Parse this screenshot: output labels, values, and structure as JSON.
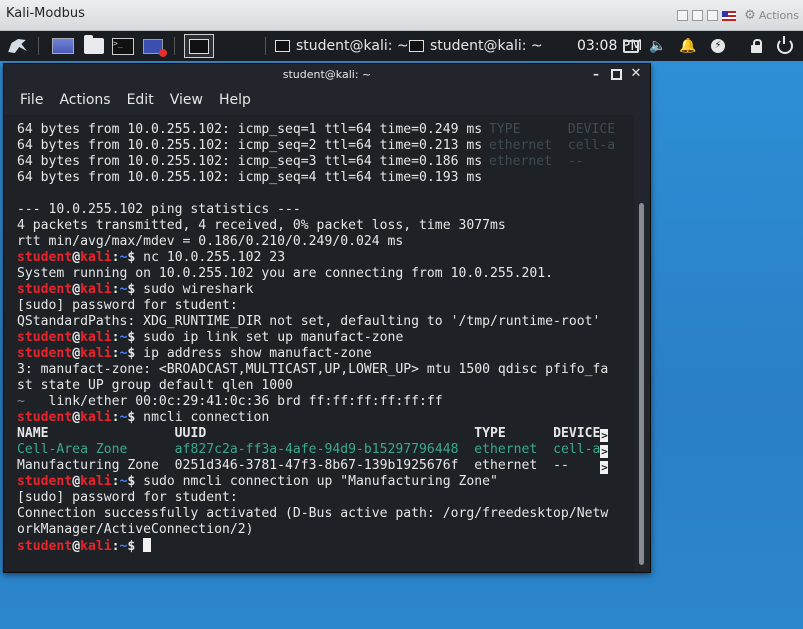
{
  "vm_window": {
    "title": "Kali-Modbus",
    "actions_label": "Actions"
  },
  "panel": {
    "icons": [
      "kali-menu-icon",
      "desktop-icon",
      "file-manager-icon",
      "terminal-launcher-icon",
      "screen-recorder-icon",
      "active-terminal-icon"
    ],
    "tasks": [
      {
        "label": "student@kali: ~"
      },
      {
        "label": "student@kali: ~"
      }
    ],
    "clock": "03:08 PM",
    "tray": [
      "display-icon",
      "volume-icon",
      "bell-icon",
      "power-manager-icon",
      "lock-icon",
      "logout-icon"
    ]
  },
  "terminal": {
    "title": "student@kali: ~",
    "menu": [
      "File",
      "Actions",
      "Edit",
      "View",
      "Help"
    ],
    "prompt": {
      "user": "student",
      "at": "@",
      "host": "kali",
      "sep": ":",
      "path": "~",
      "sym": "$"
    },
    "lines": [
      {
        "type": "text",
        "text": "64 bytes from 10.0.255.102: icmp_seq=1 ttl=64 time=0.249 ms",
        "ghost": "TYPE      DEVICE"
      },
      {
        "type": "text",
        "text": "64 bytes from 10.0.255.102: icmp_seq=2 ttl=64 time=0.213 ms",
        "ghost": "ethernet  cell-a"
      },
      {
        "type": "text",
        "text": "64 bytes from 10.0.255.102: icmp_seq=3 ttl=64 time=0.186 ms",
        "ghost": "ethernet  --"
      },
      {
        "type": "text",
        "text": "64 bytes from 10.0.255.102: icmp_seq=4 ttl=64 time=0.193 ms"
      },
      {
        "type": "blank"
      },
      {
        "type": "text",
        "text": "--- 10.0.255.102 ping statistics ---"
      },
      {
        "type": "text",
        "text": "4 packets transmitted, 4 received, 0% packet loss, time 3077ms"
      },
      {
        "type": "text",
        "text": "rtt min/avg/max/mdev = 0.186/0.210/0.249/0.024 ms"
      },
      {
        "type": "prompt",
        "cmd": "nc 10.0.255.102 23"
      },
      {
        "type": "text",
        "text": "System running on 10.0.255.102 you are connecting from 10.0.255.201."
      },
      {
        "type": "prompt",
        "cmd": "sudo wireshark"
      },
      {
        "type": "text",
        "text": "[sudo] password for student:"
      },
      {
        "type": "text",
        "text": "QStandardPaths: XDG_RUNTIME_DIR not set, defaulting to '/tmp/runtime-root'"
      },
      {
        "type": "prompt",
        "cmd": "sudo ip link set up manufact-zone"
      },
      {
        "type": "prompt",
        "cmd": "ip address show manufact-zone"
      },
      {
        "type": "text",
        "text": "3: manufact-zone: <BROADCAST,MULTICAST,UP,LOWER_UP> mtu 1500 qdisc pfifo_fa"
      },
      {
        "type": "text",
        "text": "st state UP group default qlen 1000"
      },
      {
        "type": "text",
        "text": "    link/ether 00:0c:29:41:0c:36 brd ff:ff:ff:ff:ff:ff",
        "dim_prefix": "~"
      },
      {
        "type": "prompt",
        "cmd": "nmcli connection"
      },
      {
        "type": "nm",
        "style": "hdr",
        "name": "NAME",
        "uuid": "UUID",
        "ctype": "TYPE",
        "device": "DEVICE",
        "arrow": ">"
      },
      {
        "type": "nm",
        "style": "green",
        "name": "Cell-Area Zone",
        "uuid": "af827c2a-ff3a-4afe-94d9-b15297796448",
        "ctype": "ethernet",
        "device": "cell-a",
        "arrow": ">"
      },
      {
        "type": "nm",
        "style": "plain",
        "name": "Manufacturing Zone",
        "uuid": "0251d346-3781-47f3-8b67-139b1925676f",
        "ctype": "ethernet",
        "device": "--",
        "arrow": ">"
      },
      {
        "type": "prompt",
        "cmd": "sudo nmcli connection up \"Manufacturing Zone\""
      },
      {
        "type": "text",
        "text": "[sudo] password for student:"
      },
      {
        "type": "text",
        "text": "Connection successfully activated (D-Bus active path: /org/freedesktop/Netw"
      },
      {
        "type": "text",
        "text": "orkManager/ActiveConnection/2)"
      },
      {
        "type": "prompt",
        "cmd": "",
        "cursor": true
      }
    ]
  }
}
